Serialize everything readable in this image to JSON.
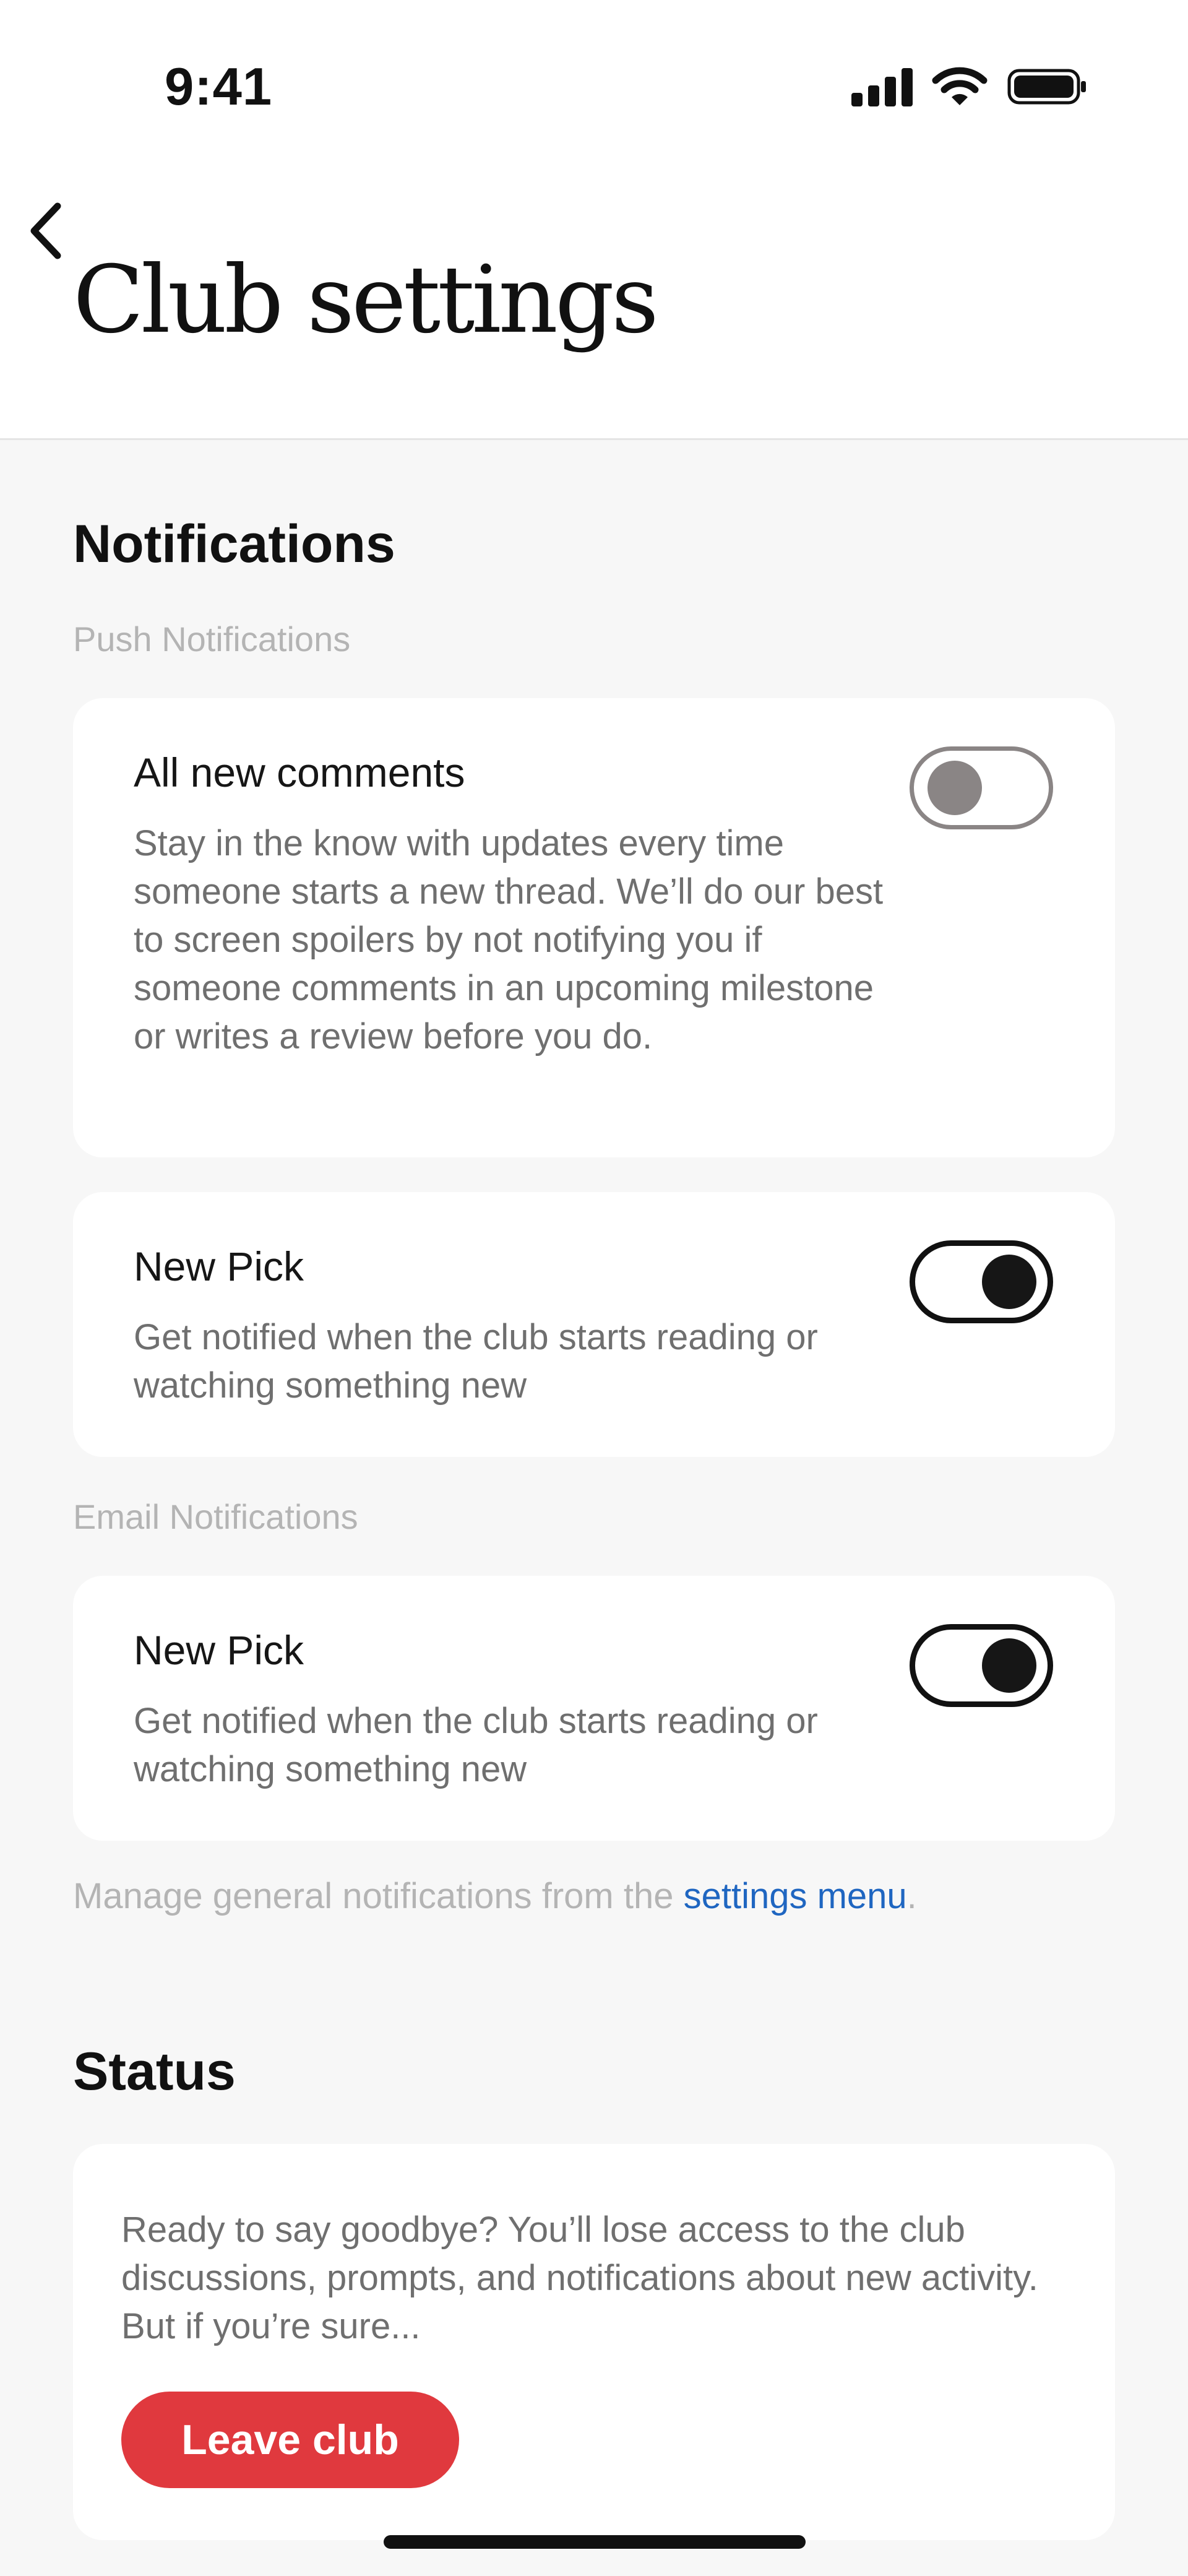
{
  "status_bar": {
    "time": "9:41"
  },
  "header": {
    "title": "Club settings"
  },
  "notifications": {
    "heading": "Notifications",
    "push_label": "Push Notifications",
    "push_items": [
      {
        "title": "All new comments",
        "description": "Stay in the know with updates every time someone starts a new thread. We’ll do our best to screen spoilers by not notifying you if someone comments in an upcoming milestone or writes a review before you do.",
        "enabled": false
      },
      {
        "title": "New Pick",
        "description": "Get notified when the club starts reading or watching something new",
        "enabled": true
      }
    ],
    "email_label": "Email Notifications",
    "email_items": [
      {
        "title": "New Pick",
        "description": "Get notified when the club starts reading or watching something new",
        "enabled": true
      }
    ],
    "footnote_prefix": "Manage general notifications from the ",
    "footnote_link": "settings menu",
    "footnote_suffix": "."
  },
  "status": {
    "heading": "Status",
    "description": "Ready to say goodbye? You’ll lose access to the club discussions, prompts, and notifications about new activity. But if you’re sure...",
    "leave_button": "Leave club"
  },
  "colors": {
    "accent_red": "#e0393e",
    "link_blue": "#1f66c1",
    "toggle_on": "#161616",
    "toggle_off": "#8a8585"
  },
  "icons": {
    "back": "chevron-left-icon",
    "signal": "cellular-signal-icon",
    "wifi": "wifi-icon",
    "battery": "battery-icon"
  }
}
